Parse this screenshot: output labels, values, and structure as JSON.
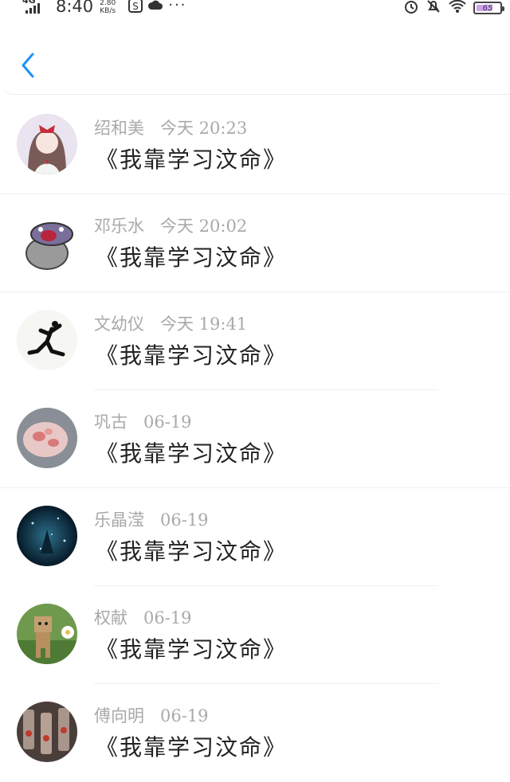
{
  "status_bar": {
    "network": "4G",
    "time": "8:40",
    "speed_value": "2.80",
    "speed_unit": "KB/s",
    "battery": "65"
  },
  "comments": [
    {
      "name": "绍和美",
      "date": "今天 20:23",
      "text": "《我靠学习汶命》"
    },
    {
      "name": "邓乐水",
      "date": "今天 20:02",
      "text": "《我靠学习汶命》"
    },
    {
      "name": "文幼仪",
      "date": "今天 19:41",
      "text": "《我靠学习汶命》"
    },
    {
      "name": "巩古",
      "date": "06-19",
      "text": "《我靠学习汶命》"
    },
    {
      "name": "乐晶滢",
      "date": "06-19",
      "text": "《我靠学习汶命》"
    },
    {
      "name": "权献",
      "date": "06-19",
      "text": "《我靠学习汶命》"
    },
    {
      "name": "傅向明",
      "date": "06-19",
      "text": "《我靠学习汶命》"
    }
  ],
  "colors": {
    "accent": "#1e90ff",
    "meta_text": "#a9a9a9",
    "title_text": "#222222"
  }
}
